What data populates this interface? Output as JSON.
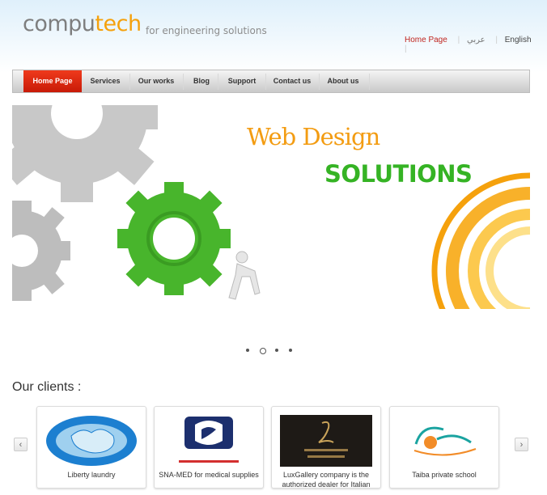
{
  "header": {
    "logo_part1": "compu",
    "logo_part2": "tech",
    "tagline": "for engineering solutions",
    "lang_links": [
      "Home Page",
      "عربي",
      "English"
    ]
  },
  "nav": {
    "items": [
      "Home Page",
      "Services",
      "Our works",
      "Blog",
      "Support",
      "Contact us",
      "About us"
    ],
    "active": "Home Page"
  },
  "banner": {
    "line1": "Web Design",
    "line2": "SOLUTIONS"
  },
  "slider": {
    "dot_count": 4,
    "active_dot": 2
  },
  "clients": {
    "title": "Our clients :",
    "items": [
      {
        "name": "Liberty laundry",
        "logo": "we-care-you-wear-logo"
      },
      {
        "name": "SNA-MED for medical supplies",
        "logo": "snamed-logo"
      },
      {
        "name": "LuxGallery company is the authorized dealer for Italian",
        "logo": "lux-gallery-logo"
      },
      {
        "name": "Taiba private school",
        "logo": "taiba-school-logo"
      }
    ],
    "prev": "‹",
    "next": "›"
  },
  "colors": {
    "accent_red": "#c81a07",
    "brand_orange": "#f5a10c",
    "green": "#35b324"
  }
}
